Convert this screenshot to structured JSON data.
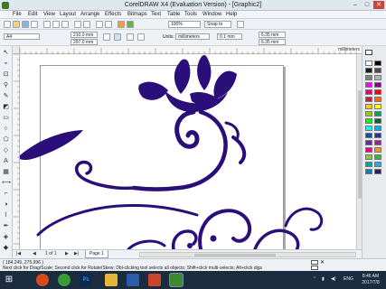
{
  "window": {
    "title": "CorelDRAW X4 (Evaluation Version) - [Graphic2]",
    "controls": {
      "minimize": "–",
      "maximize": "□",
      "close": "✕"
    }
  },
  "menubar": {
    "items": [
      "File",
      "Edit",
      "View",
      "Layout",
      "Arrange",
      "Effects",
      "Bitmaps",
      "Text",
      "Table",
      "Tools",
      "Window",
      "Help"
    ]
  },
  "toolbar": {
    "zoom_value": "100%",
    "snap_value": "Snap to",
    "icons": [
      "new-icon",
      "open-icon",
      "save-icon",
      "print-icon",
      "cut-icon",
      "copy-icon",
      "paste-icon",
      "undo-icon",
      "redo-icon",
      "import-icon",
      "export-icon",
      "application-launcher-icon",
      "welcome-icon"
    ]
  },
  "property_bar": {
    "paper_size": "A4",
    "width": "210.0 mm",
    "height": "297.0 mm",
    "units_label": "Units:",
    "units_value": "millimeters",
    "nudge": "0.1 mm",
    "dup_x": "6.35 mm",
    "dup_y": "6.35 mm"
  },
  "ruler": {
    "unit": "millimeters"
  },
  "page_nav": {
    "counter": "1 of 1",
    "page_tab": "Page 1"
  },
  "status": {
    "coords": "( 184.245, 275.996 )",
    "hint": "Next click for Drag/Scale; Second click for Rotate/Skew; Dbl-clicking tool selects all objects; Shift+click multi-selects; Alt+click digs",
    "fill_none": "✕"
  },
  "taskbar": {
    "lang": "ENG",
    "time": "8:46 AM",
    "date": "2017/7/8",
    "apps": [
      "windows-start-icon",
      "firefox-icon",
      "chrome-icon",
      "photoshop-icon",
      "folder-icon",
      "word-icon",
      "powerpoint-icon",
      "coreldraw-icon"
    ]
  },
  "colors": {
    "accent": "#2a0e7a",
    "palette": [
      "#ffffff",
      "#000000",
      "#1a1a1a",
      "#4d4d4d",
      "#808080",
      "#b3b3b3",
      "#ff00ff",
      "#8b008b",
      "#e6007e",
      "#ff0000",
      "#c41e3a",
      "#ff6600",
      "#ffcc00",
      "#ffff00",
      "#99cc00",
      "#00a651",
      "#00ff00",
      "#006837",
      "#00ffff",
      "#00aeef",
      "#0054a6",
      "#2e3192",
      "#662d91",
      "#92278f",
      "#ec008c",
      "#f7941d",
      "#8dc63f",
      "#39b54a",
      "#00a99d",
      "#27aae1",
      "#1c75bc",
      "#262262"
    ]
  }
}
